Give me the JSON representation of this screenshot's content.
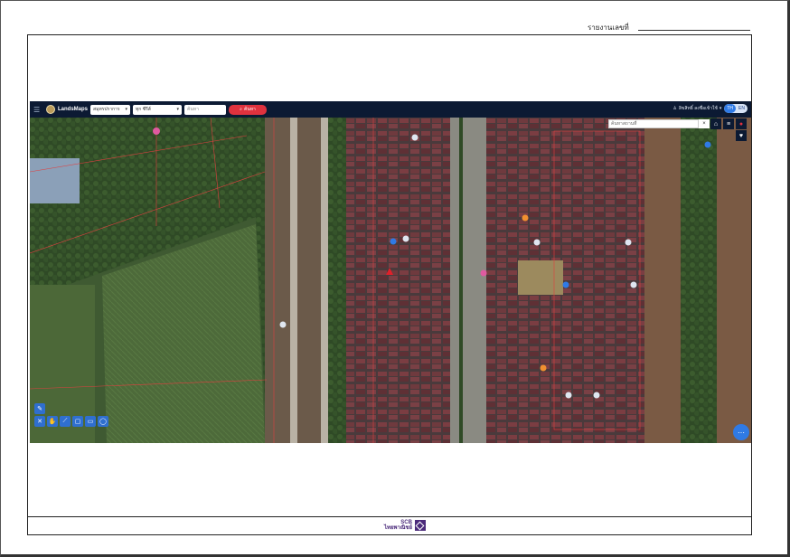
{
  "header": {
    "report_label": "รายงานเลขที่"
  },
  "app": {
    "brand": "LandsMaps",
    "selects": [
      {
        "value": "สมุทรปราการ"
      },
      {
        "value": "ทุก ซีรีส์"
      }
    ],
    "search_placeholder": "ค้นหา",
    "search_button": "ค้นหา",
    "user_name": "ลิขสิทธิ์ ลงชื่อเข้าใช้",
    "languages": [
      "TH",
      "EN"
    ]
  },
  "map": {
    "search_placeholder": "ค้นหาสถานที่",
    "close_label": "×"
  },
  "footer": {
    "logo_text_1": "SCB",
    "logo_text_2": "ไทยพาณิชย์"
  },
  "colors": {
    "topbar": "#0c1a33",
    "accent_red": "#e0323e",
    "accent_blue": "#2f7ae5",
    "brand_purple": "#4b2a7b"
  }
}
